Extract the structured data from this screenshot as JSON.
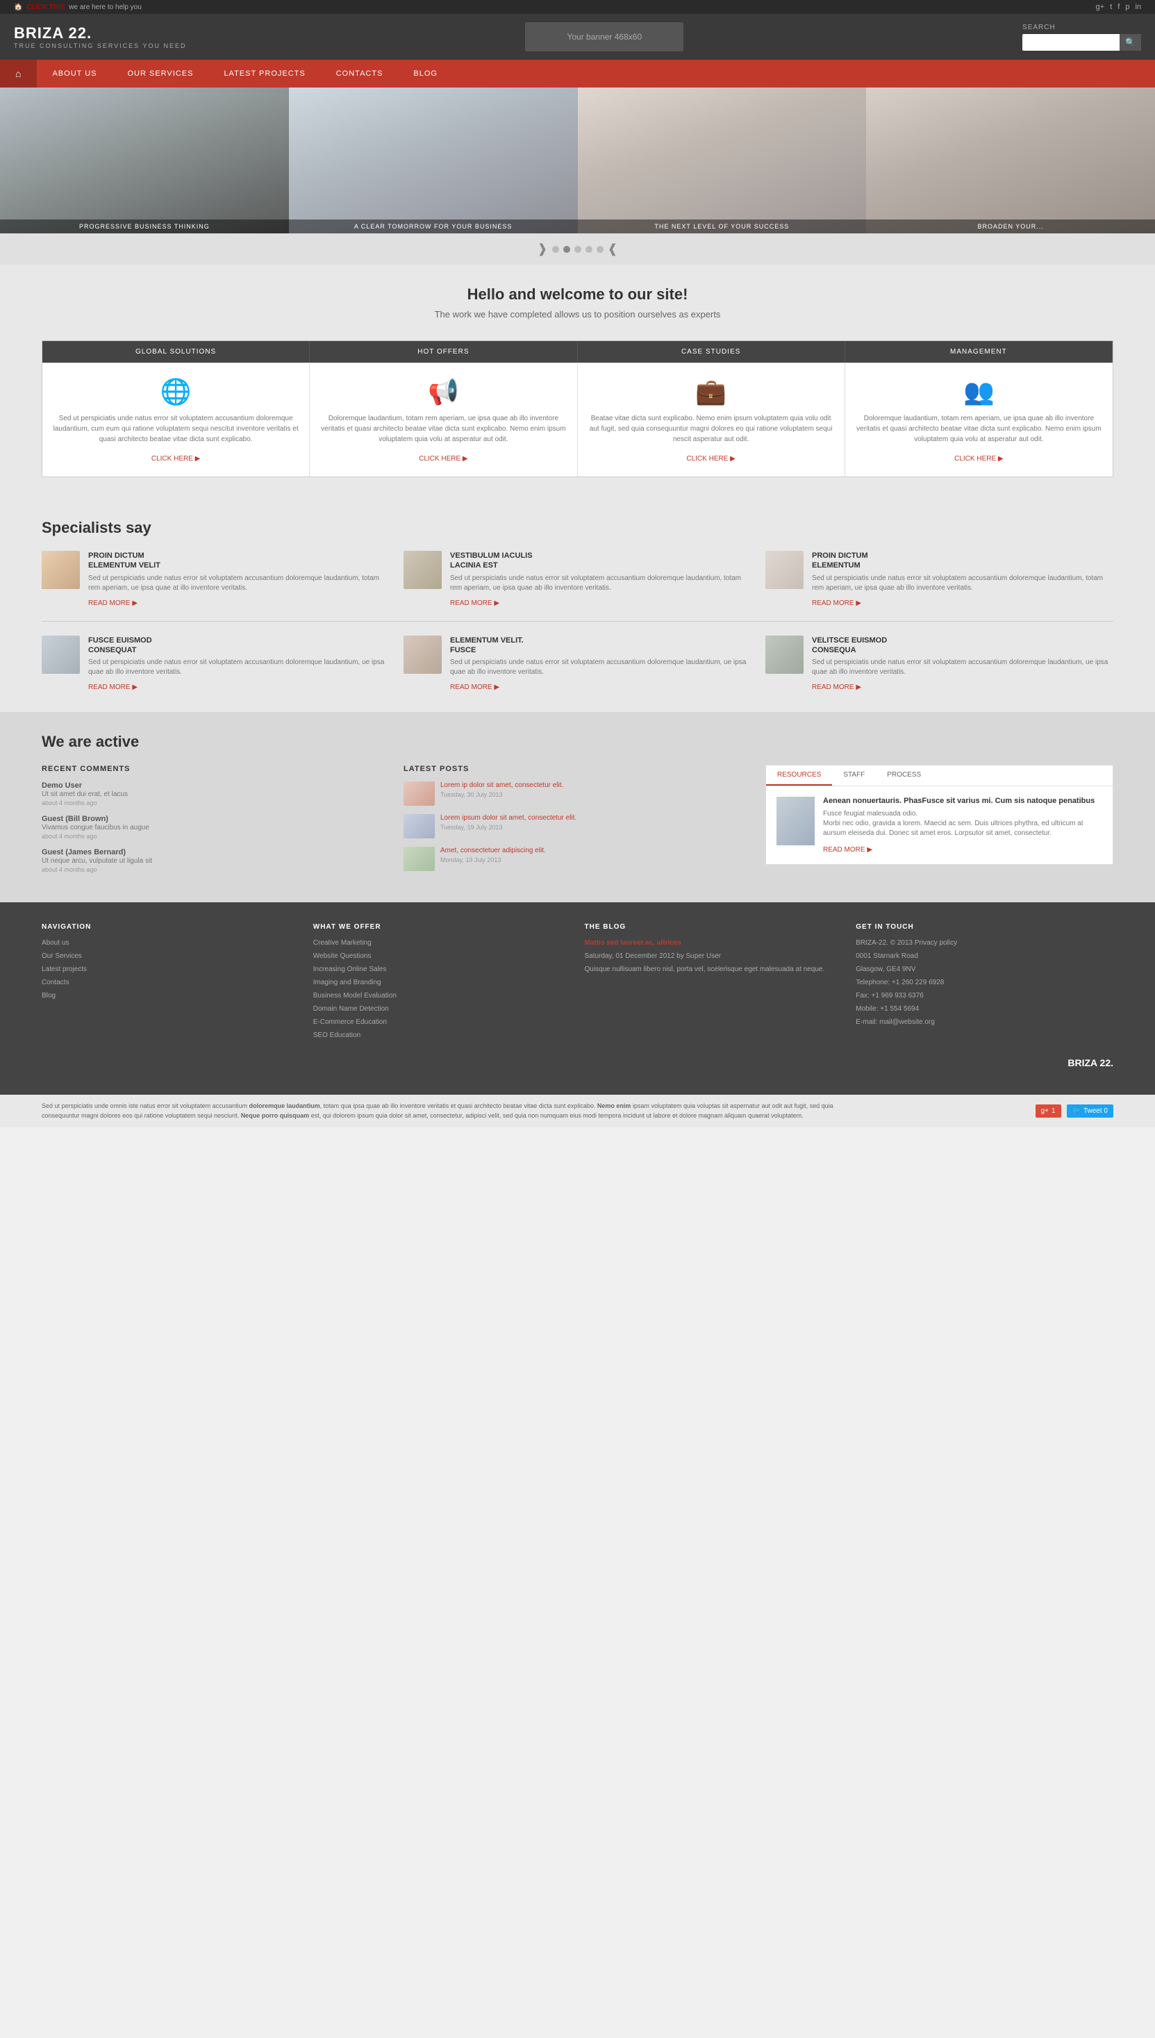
{
  "topbar": {
    "left_link": "CLICK THIS",
    "left_text": "we are here to help you",
    "social_icons": [
      "g+",
      "t",
      "f",
      "p",
      "in"
    ]
  },
  "header": {
    "logo_title": "BRIZA 22.",
    "logo_subtitle": "TRUE CONSULTING SERVICES YOU NEED",
    "banner_text": "Your banner 468x60",
    "search_label": "SEARCH",
    "search_placeholder": ""
  },
  "nav": {
    "home_icon": "⌂",
    "items": [
      "ABOUT US",
      "OUR SERVICES",
      "LATEST PROJECTS",
      "CONTACTS",
      "BLOG"
    ]
  },
  "hero": {
    "panels": [
      {
        "caption": "PROGRESSIVE BUSINESS THINKING"
      },
      {
        "caption": "A CLEAR TOMORROW FOR YOUR BUSINESS"
      },
      {
        "caption": "THE NEXT LEVEL OF YOUR SUCCESS"
      },
      {
        "caption": "BROADEN YOUR..."
      }
    ],
    "dots": 5,
    "active_dot": 1
  },
  "welcome": {
    "heading": "Hello and welcome to our site!",
    "subheading": "The work we have completed allows us to position ourselves as experts"
  },
  "services": {
    "headers": [
      "GLOBAL SOLUTIONS",
      "HOT OFFERS",
      "CASE STUDIES",
      "MANAGEMENT"
    ],
    "icons": [
      "🌐",
      "📢",
      "💼",
      "👥"
    ],
    "texts": [
      "Sed ut perspiciatis unde natus error sit voluptatem accusantium doloremque laudantium, cum eum qui ratione voluptatem sequi nescitut inventore veritatis et quasi architecto beatae vitae dicta sunt explicabo.",
      "Doloremque laudantium, totam rem aperiam, ue ipsa quae ab illo inventore veritatis et quasi architecto beatae vitae dicta sunt explicabo. Nemo enim ipsum voluptatem quia volu at asperatur aut odit.",
      "Beatae vitae dicta sunt explicabo. Nemo enim ipsum voluptatem quia volu odit aut fugit, sed quia consequuntur magni dolores eo qui ratione voluptatem sequi nescit asperatur aut odit.",
      "Doloremque laudantium, totam rem aperiam, ue ipsa quae ab illo inventore veritatis et quasi architecto beatae vitae dicta sunt explicabo. Nemo enim ipsum voluptatem quia volu at asperatur aut odit."
    ],
    "click_here": "CLICK HERE"
  },
  "specialists": {
    "heading": "Specialists say",
    "items": [
      {
        "name": "PROIN DICTUM ELEMENTUM VELIT",
        "text": "Sed ut perspiciatis unde natus error sit voluptatem accusantium doloremque laudantium, totam rem aperiam, ue ipsa quae at illo inventore veritatis.",
        "read_more": "READ MORE",
        "avatar_class": "av1"
      },
      {
        "name": "VESTIBULUM IACULIS LACINIA EST",
        "text": "Sed ut perspiciatis unde natus error sit voluptatem accusantium doloremque laudantium, totam rem aperiam, ue ipsa quae ab illo inventore veritatis.",
        "read_more": "READ MORE",
        "avatar_class": "av2"
      },
      {
        "name": "PROIN DICTUM ELEMENTUM",
        "text": "Sed ut perspiciatis unde natus error sit voluptatem accusantium doloremque laudantium, totam rem aperiam, ue ipsa quae ab illo inventore veritatis.",
        "read_more": "READ MORE",
        "avatar_class": "av3"
      },
      {
        "name": "FUSCE EUISMOD CONSEQUAT",
        "text": "Sed ut perspiciatis unde natus error sit voluptatem accusantium doloremque laudantium, ue ipsa quae ab illo inventore veritatis.",
        "read_more": "READ MORE",
        "avatar_class": "av4"
      },
      {
        "name": "ELEMENTUM VELIT. FUSCE",
        "text": "Sed ut perspiciatis unde natus error sit voluptatem accusantium doloremque laudantium, ue ipsa quae ab illo inventore veritatis.",
        "read_more": "READ MORE",
        "avatar_class": "av5"
      },
      {
        "name": "VELITSCE EUISMOD CONSEQUA",
        "text": "Sed ut perspiciatis unde natus error sit voluptatem accusantium doloremque laudantium, ue ipsa quae ab illo inventore veritatis.",
        "read_more": "READ MORE",
        "avatar_class": "av6"
      }
    ]
  },
  "active": {
    "heading": "We are active",
    "recent_comments": {
      "label": "RECENT COMMENTS",
      "items": [
        {
          "user": "Demo User",
          "text": "Ut sit amet dui erat, et lacus about 4 months ago",
          "time": "about 4 months ago"
        },
        {
          "user": "Guest (Bill Brown)",
          "text": "Vivamus congue faucibus in augue about 4 months ago",
          "time": "about 4 months ago"
        },
        {
          "user": "Guest (James Bernard)",
          "text": "Ut neque arcu, vulputate ut ligula sit about 4 months ago",
          "time": "about 4 months ago"
        }
      ]
    },
    "latest_posts": {
      "label": "LATEST POSTS",
      "items": [
        {
          "title": "Lorem ip dolor sit amet, consectetur elit.",
          "date": "Tuesday, 30 July 2013",
          "thumb_class": "post-thumb-1"
        },
        {
          "title": "Lorem ipsum dolor sit amet, consectetur elit.",
          "date": "Tuesday, 19 July 2013",
          "thumb_class": "post-thumb-2"
        },
        {
          "title": "Amet, consectetuer adipiscing elit.",
          "date": "Monday, 19 July 2013",
          "thumb_class": "post-thumb-3"
        }
      ]
    },
    "resources": {
      "tabs": [
        "RESOURCES",
        "STAFF",
        "PROCESS"
      ],
      "active_tab": "RESOURCES",
      "heading": "Aenean nonuertauris. PhasFusce sit varius mi. Cum sis natoque penatibus",
      "body1": "Fusce feugiat malesuada odio.",
      "body2": "Morbi nec odio, gravida a lorem. Maecid ac sem. Duis ultrices phythra, ed ultricum at aursum eleiseda dui. Donec sit amet eros. Lorpsutor sit amet, consectetur.",
      "read_more": "READ MORE"
    }
  },
  "footer": {
    "navigation": {
      "label": "NAVIGATION",
      "links": [
        "About us",
        "Our Services",
        "Latest projects",
        "Contacts",
        "Blog"
      ]
    },
    "what_we_offer": {
      "label": "WHAT WE OFFER",
      "links": [
        "Creative Marketing",
        "Website Questions",
        "Increasing Online Sales",
        "Imaging and Branding",
        "Business Model Evaluation",
        "Domain Name Detection",
        "E-Commerce Education",
        "SEO Education"
      ]
    },
    "the_blog": {
      "label": "THE BLOG",
      "post_title": "Mattis sed laoreet ac, ultrices",
      "post_meta": "Saturday, 01 December 2012 by Super User",
      "post_text": "Quisque nullisuam libero nisl, porta vel, scelerisque eget malesuada at neque."
    },
    "get_in_touch": {
      "label": "GET IN TOUCH",
      "brand": "BRIZA-22. © 2013 Privacy policy",
      "address": "0001 Starnark Road",
      "city": "Glasgow, GE4 9NV",
      "telephone": "+1 260 229 6928",
      "fax": "+1 969 933 6376",
      "mobile": "+1 554 5694",
      "email": "mail@website.org"
    },
    "logo": "BRIZA 22.",
    "bottom_text": "Sed ut perspiciatis unde omnis iste natus error sit voluptatem accusantium doloremque laudantium. totam qua ipsa quae ab illo inventore veritatis et quasi architecto beatae vitae dicta sunt explicabo. Nemo enim ipsam voluptatem quia voluptas sit aspernatur aut odit aut fugit, sed quia consequuntur magni dolores eos qui ratione voluptatem sequi nesciunt. Neque porro quisquam est, qui dolorem ipsum quia dolor sit amet, consectetur, adipisci velit, sed quia non numquam eius modi tempora incidunt ut labore et dolore magnam aliquam quaerat voluptatem.",
    "social_share_1": "Google+1",
    "social_share_2": "Tweet 0"
  }
}
